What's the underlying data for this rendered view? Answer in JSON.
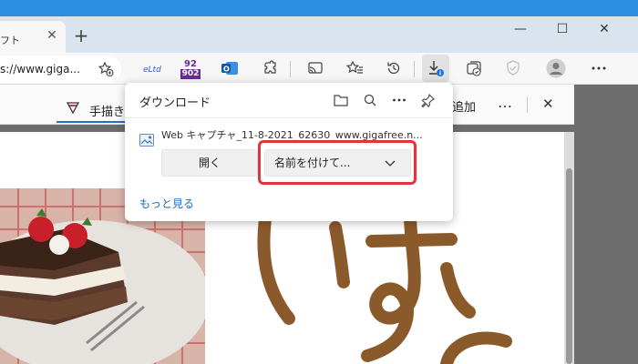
{
  "window": {
    "minimize_glyph": "—",
    "maximize_glyph": "☐",
    "close_glyph": "✕"
  },
  "tab": {
    "title": "フト",
    "close_glyph": "✕"
  },
  "new_tab_glyph": "+",
  "address": {
    "url": "s://www.giga..."
  },
  "toolbar_icons": [
    "favorite-add-icon",
    "extension-icon",
    "counter-badge-icon",
    "outlook-icon",
    "puzzle-icon",
    "cast-icon",
    "favorites-icon",
    "history-icon",
    "download-icon",
    "collections-icon",
    "shield-icon",
    "profile-icon",
    "more-icon"
  ],
  "badge": {
    "top": "92",
    "bottom": "902"
  },
  "doc_toolbar": {
    "draw_label": "手描き",
    "add_label": "追加",
    "more_glyph": "…",
    "close_glyph": "✕"
  },
  "downloads": {
    "title": "ダウンロード",
    "item": {
      "filename": "Web キャプチャ_11-8-2021_62630_www.gigafree.n..."
    },
    "open_button": "開く",
    "save_as_button": "名前を付けて...",
    "more_link": "もっと見る"
  },
  "colors": {
    "accent": "#2c8ee0",
    "link": "#1a6ac0",
    "highlight": "#e63339",
    "ink": "#8b5a2b"
  },
  "drawing": {
    "text": "いすと"
  }
}
